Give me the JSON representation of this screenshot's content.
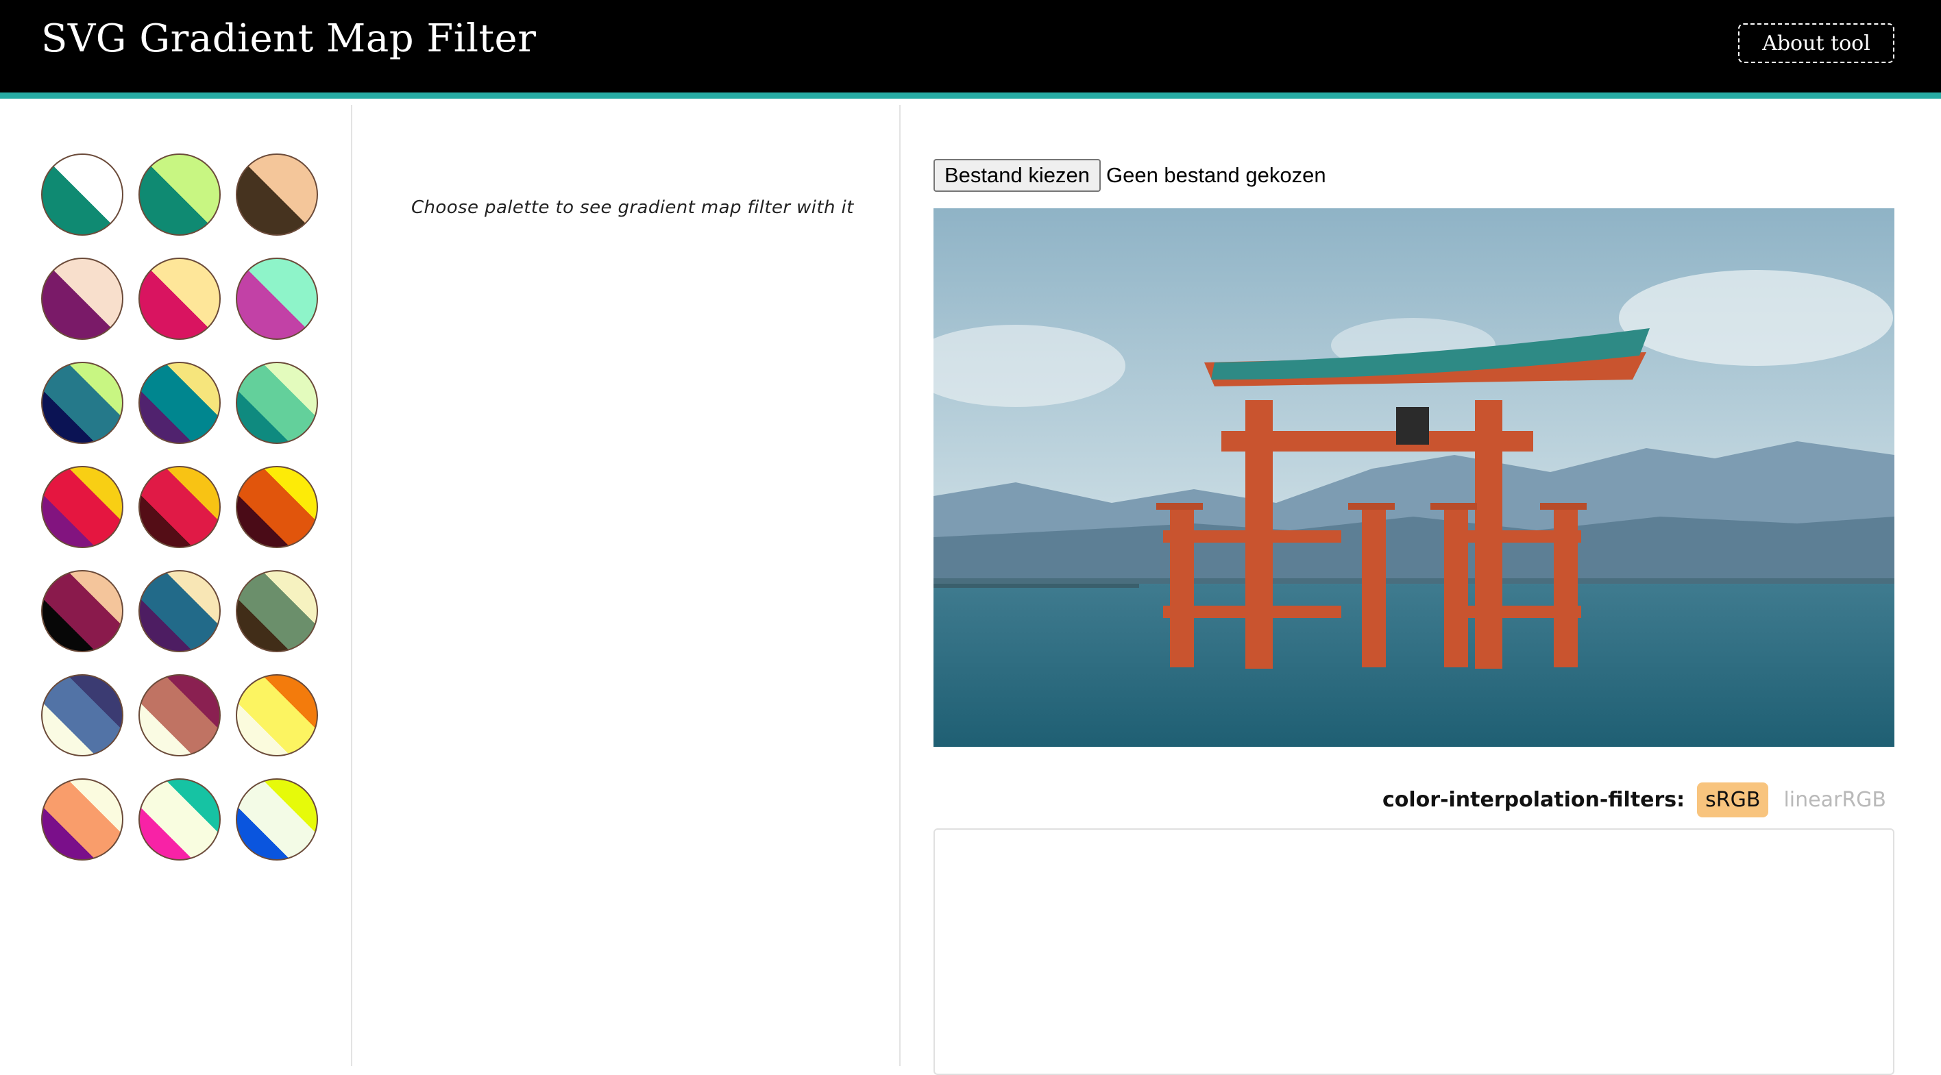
{
  "header": {
    "title": "SVG Gradient Map Filter",
    "about_label": "About tool"
  },
  "palettes": [
    {
      "dark": "#0f8a72",
      "light": "#ffffff"
    },
    {
      "dark": "#0f8a72",
      "light": "#c8f682"
    },
    {
      "dark": "#46331f",
      "light": "#f4c69a"
    },
    {
      "dark": "#7a1a68",
      "light": "#f8dfcc"
    },
    {
      "dark": "#d91460",
      "light": "#fee699"
    },
    {
      "dark": "#c241a6",
      "light": "#8ef4c9"
    },
    {
      "dark": "#0b1354",
      "mid": "#25798a",
      "light": "#c8f682"
    },
    {
      "dark": "#50226e",
      "mid": "#00868f",
      "light": "#f6e57c"
    },
    {
      "dark": "#0f8a7f",
      "mid": "#63d09b",
      "light": "#e3fbbd"
    },
    {
      "dark": "#82147f",
      "mid": "#e51640",
      "light": "#f8cf14"
    },
    {
      "dark": "#540d16",
      "mid": "#e01a46",
      "light": "#f8c314"
    },
    {
      "dark": "#4a0b17",
      "mid": "#e1550c",
      "light": "#fdeb07"
    },
    {
      "dark": "#070707",
      "mid": "#8a1a4c",
      "light": "#f4c59b"
    },
    {
      "dark": "#4d1d62",
      "mid": "#226a89",
      "light": "#f8e6b5"
    },
    {
      "dark": "#412d18",
      "mid": "#6b8f6b",
      "light": "#f6f2c0"
    },
    {
      "dark": "#fafbe3",
      "mid": "#5273a6",
      "light": "#3b3b72"
    },
    {
      "dark": "#fafbe3",
      "mid": "#c07363",
      "light": "#8a2051"
    },
    {
      "dark": "#fbfbdd",
      "mid": "#fcf461",
      "light": "#f37b0c"
    },
    {
      "dark": "#7a0f8a",
      "mid": "#f99d6b",
      "light": "#fbfbdf"
    },
    {
      "dark": "#f822a6",
      "mid": "#f9fde0",
      "light": "#16c3a3"
    },
    {
      "dark": "#0a55de",
      "mid": "#f3fbe6",
      "light": "#e6fa0a"
    }
  ],
  "main": {
    "hint": "Choose palette to see gradient map filter with it",
    "file_button": "Bestand kiezen",
    "file_status": "Geen bestand gekozen",
    "cif_label": "color-interpolation-filters:",
    "cif_options": [
      "sRGB",
      "linearRGB"
    ],
    "cif_selected": "sRGB"
  }
}
